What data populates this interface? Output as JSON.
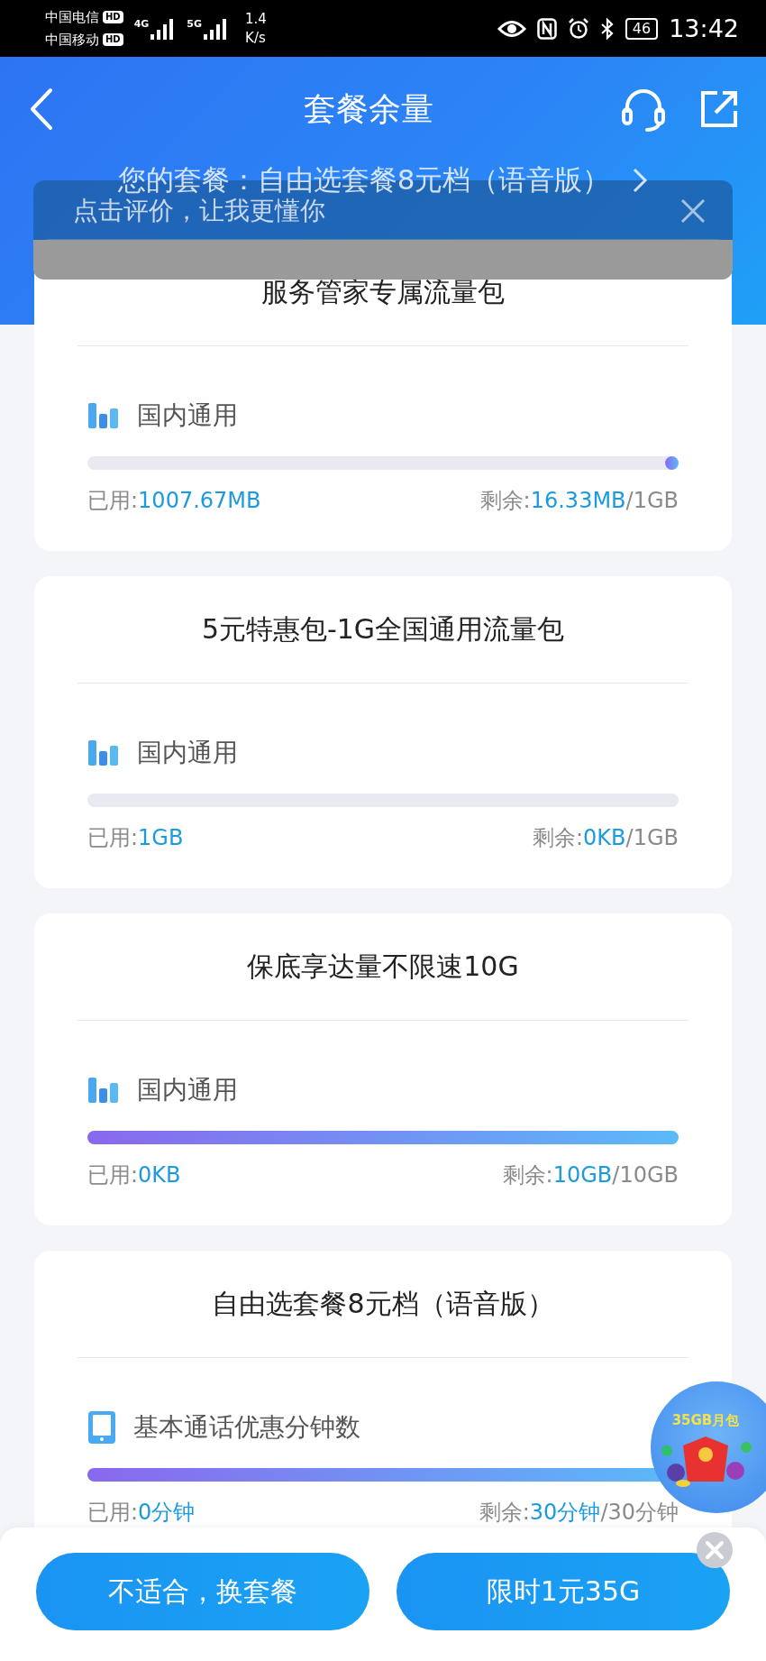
{
  "status_bar": {
    "carriers": [
      {
        "name": "中国电信",
        "badge": "HD"
      },
      {
        "name": "中国移动",
        "badge": "HD"
      }
    ],
    "networks": [
      "4G",
      "5G"
    ],
    "speed": [
      "1.4",
      "K/s"
    ],
    "battery": "46",
    "time": "13:42"
  },
  "header": {
    "title": "套餐余量",
    "plan": "您的套餐：自由选套餐8元档（语音版）"
  },
  "toast": {
    "text": "点击评价，让我更懂你"
  },
  "packages": [
    {
      "title": "服务管家专属流量包",
      "kind": "data",
      "label": "国内通用",
      "used_label": "已用:",
      "used": "1007.67MB",
      "remaining_label": "剩余:",
      "remaining": "16.33MB",
      "total": "/1GB",
      "level": 0.016
    },
    {
      "title": "5元特惠包-1G全国通用流量包",
      "kind": "data",
      "label": "国内通用",
      "used_label": "已用:",
      "used": "1GB",
      "remaining_label": "剩余:",
      "remaining": "0KB",
      "total": "/1GB"
    },
    {
      "title": "保底享达量不限速10G",
      "kind": "data",
      "label": "国内通用",
      "used_label": "已用:",
      "used": "0KB",
      "remaining_label": "剩余:",
      "remaining": "10GB",
      "total": "/10GB",
      "level": 1
    },
    {
      "title": "自由选套餐8元档（语音版）",
      "kind": "voice",
      "label": "基本通话优惠分钟数",
      "used_label": "已用:",
      "used": "0分钟",
      "remaining_label": "剩余:",
      "remaining": "30分钟",
      "total": "/30分钟",
      "level": 1
    }
  ],
  "promo_badge": {
    "text": "35GB月包"
  },
  "buttons": [
    {
      "label": "不适合，换套餐"
    },
    {
      "label": "限时1元35G"
    }
  ]
}
